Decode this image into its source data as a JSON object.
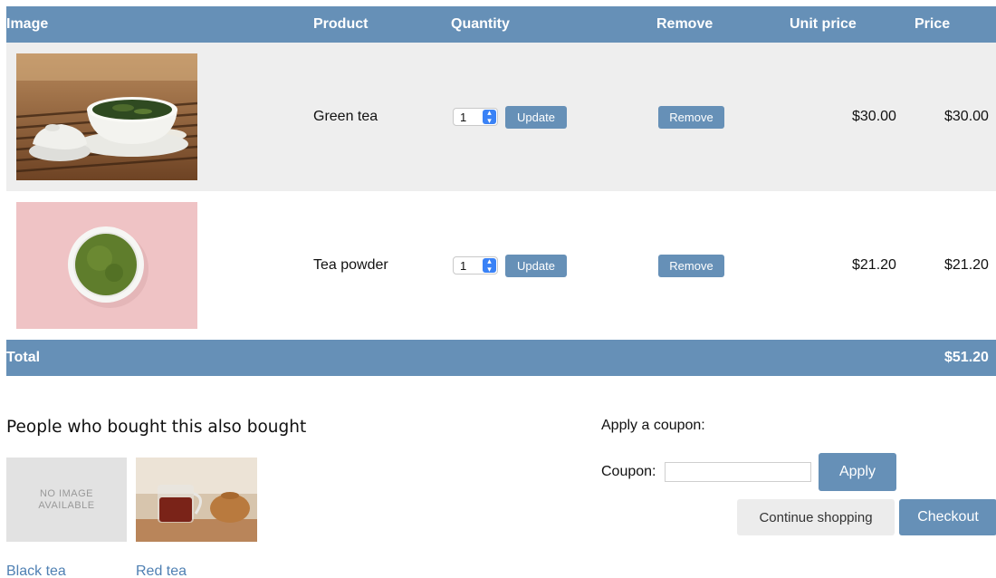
{
  "table": {
    "headers": {
      "image": "Image",
      "product": "Product",
      "quantity": "Quantity",
      "remove": "Remove",
      "unit_price": "Unit price",
      "price": "Price"
    },
    "items": [
      {
        "product": "Green tea",
        "quantity": "1",
        "update_label": "Update",
        "remove_label": "Remove",
        "unit_price": "$30.00",
        "price": "$30.00"
      },
      {
        "product": "Tea powder",
        "quantity": "1",
        "update_label": "Update",
        "remove_label": "Remove",
        "unit_price": "$21.20",
        "price": "$21.20"
      }
    ],
    "total_label": "Total",
    "total_value": "$51.20"
  },
  "also_bought": {
    "title": "People who bought this also bought",
    "items": [
      {
        "name": "Black tea",
        "placeholder_line1": "NO IMAGE",
        "placeholder_line2": "AVAILABLE"
      },
      {
        "name": "Red tea"
      }
    ]
  },
  "coupon": {
    "heading": "Apply a coupon:",
    "field_label": "Coupon:",
    "value": "",
    "apply_label": "Apply"
  },
  "actions": {
    "continue_label": "Continue shopping",
    "checkout_label": "Checkout"
  },
  "colors": {
    "accent": "#6690b7",
    "link": "#4f80b3",
    "row_alt": "#eeeeee"
  },
  "icons": {
    "quantity_stepper": "up-down-chevron-icon"
  }
}
